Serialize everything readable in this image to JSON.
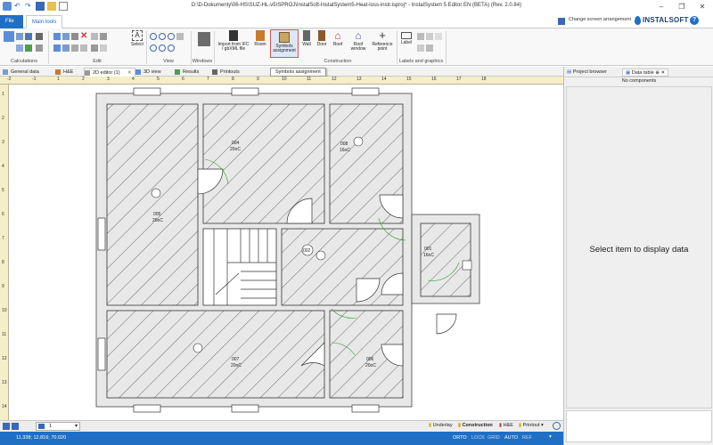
{
  "window": {
    "title": "D:\\D-Dokumenty\\06-HS\\SUZ-HL-v5\\SPROJ\\InstalSoft-InstalSystem5-Heat-loss-instr.isproj* - InstalSystem 5 Editor EN (BETA) (Rev. 2.0.84)"
  },
  "ribbon_tabs": {
    "file": "File",
    "main": "Main tools"
  },
  "header_right": {
    "arrange": "Change screen arrangement",
    "logo": "INSTALSOFT",
    "help": "?"
  },
  "ribbon": {
    "groups": {
      "calc": "Calculations",
      "edit": "Edit",
      "view": "View",
      "windows": "Windows",
      "construction": "Construction",
      "labels": "Labels and graphics"
    },
    "select": "Select",
    "import": "Import from IFC / gbXML file",
    "room": "Room",
    "symbols": "Symbols assignment",
    "wall": "Wall",
    "door": "Door",
    "roof": "Roof",
    "roofwin": "Roof window",
    "refpoint": "Reference point",
    "label": "Label"
  },
  "tooltip": "Symbols assignment",
  "doc_tabs": [
    "General data",
    "H&E",
    "2D editor (1)",
    "3D view",
    "Results",
    "Printouts"
  ],
  "ruler_h": [
    "-2",
    "-1",
    "1",
    "2",
    "3",
    "4",
    "5",
    "6",
    "7",
    "8",
    "9",
    "10",
    "11",
    "12",
    "13",
    "14",
    "15",
    "16",
    "17",
    "18"
  ],
  "ruler_v": [
    "1",
    "2",
    "3",
    "4",
    "5",
    "6",
    "7",
    "8",
    "9",
    "10",
    "11",
    "12",
    "13",
    "14"
  ],
  "rooms": [
    {
      "num": "004",
      "temp": "20oC"
    },
    {
      "num": "008",
      "temp": "16oC"
    },
    {
      "num": "005",
      "temp": "20oC"
    },
    {
      "num": "001",
      "temp": "16oC"
    },
    {
      "num": "002",
      "temp": ""
    },
    {
      "num": "007",
      "temp": "20oC"
    },
    {
      "num": "006",
      "temp": "20oC"
    }
  ],
  "floor_select": "1",
  "layers": [
    "Underlay",
    "Construction",
    "H&E",
    "Printout"
  ],
  "status": {
    "coords": "11.338; 12.816; 70.020",
    "modes": [
      "ORTO",
      "LOCK",
      "GRID",
      "AUTO",
      "REF"
    ]
  },
  "right_panel": {
    "tabs": [
      "Project browser",
      "Data table"
    ],
    "no_components": "No components",
    "message": "Select item to display data"
  }
}
